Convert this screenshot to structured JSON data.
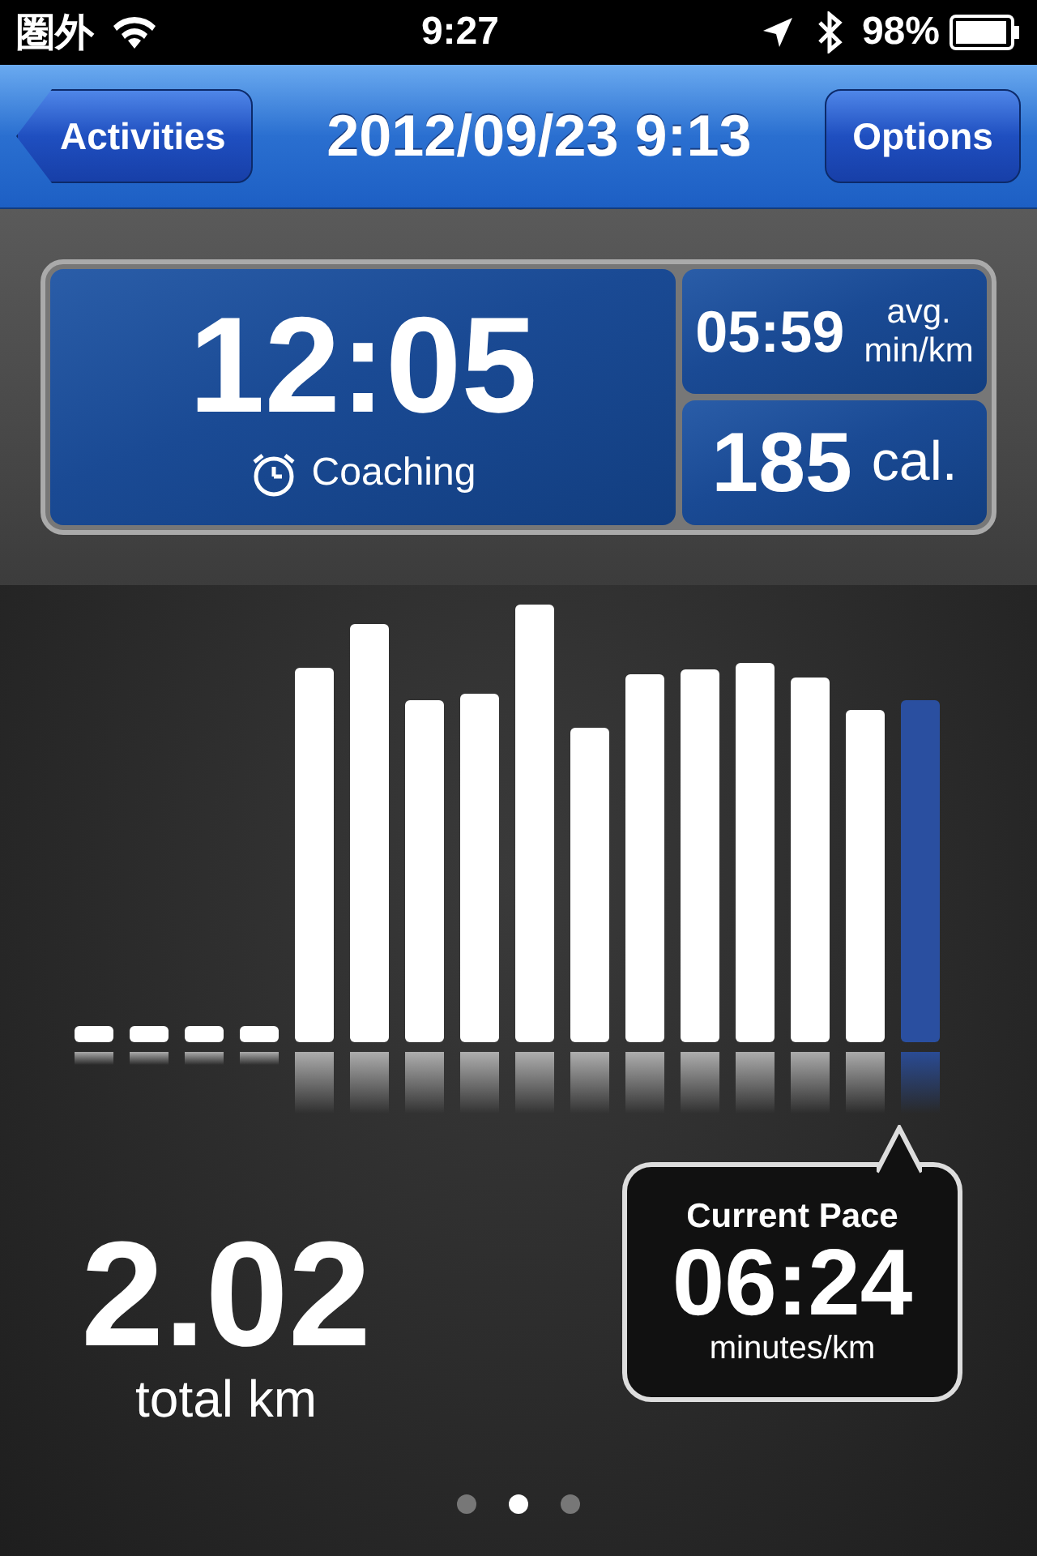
{
  "status_bar": {
    "carrier": "圏外",
    "time": "9:27",
    "battery": "98%"
  },
  "nav": {
    "back": "Activities",
    "title": "2012/09/23 9:13",
    "options": "Options"
  },
  "summary": {
    "duration": "12:05",
    "mode": "Coaching",
    "pace": "05:59",
    "pace_unit_1": "avg.",
    "pace_unit_2": "min/km",
    "calories": "185",
    "calories_unit": "cal."
  },
  "distance": {
    "value": "2.02",
    "unit": "total km"
  },
  "current_pace": {
    "title": "Current Pace",
    "value": "06:24",
    "unit": "minutes/km"
  },
  "pages": [
    {
      "selected": false
    },
    {
      "selected": true
    },
    {
      "selected": false
    }
  ]
}
